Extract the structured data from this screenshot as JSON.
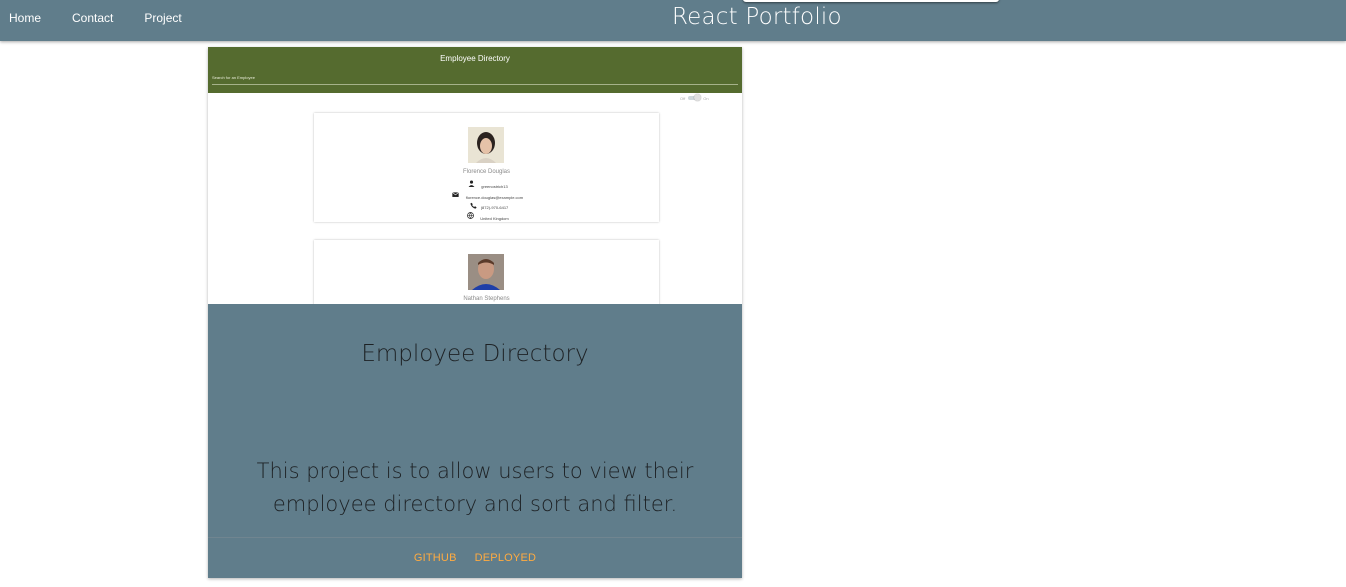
{
  "nav": {
    "links": [
      "Home",
      "Contact",
      "Project"
    ],
    "brand": "React Portfolio"
  },
  "project": {
    "screenshot": {
      "app_title": "Employee Directory",
      "search_placeholder": "Search for an Employee",
      "toggle_left": "Off",
      "toggle_right": "On",
      "employees": [
        {
          "name": "Florence Douglas",
          "username": "greenostrich13",
          "email": "florence.douglas@example.com",
          "phone": "(872)-970-6417",
          "country": "United Kingdom"
        },
        {
          "name": "Nathan Stephens"
        }
      ]
    },
    "title": "Employee Directory",
    "description": "This project is to allow users to view their employee directory and sort and filter.",
    "actions": [
      "GITHUB",
      "DEPLOYED"
    ]
  },
  "colors": {
    "navbar": "#607d8b",
    "card": "#607d8b",
    "app_header": "#556b2f",
    "action_link": "#ffab40"
  }
}
